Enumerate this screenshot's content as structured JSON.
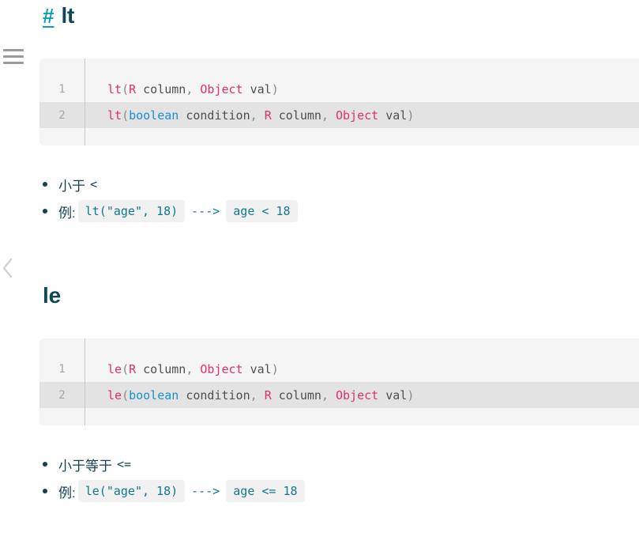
{
  "rail": {
    "menu_icon": "hamburger-menu-icon",
    "collapse_icon": "chevron-left-icon"
  },
  "sections": [
    {
      "id": "lt",
      "anchor": "#",
      "title": "lt",
      "code": {
        "lines": [
          {
            "number": "1",
            "tokens": [
              {
                "t": "lt",
                "c": "fn"
              },
              {
                "t": "(",
                "c": "punc"
              },
              {
                "t": "R",
                "c": "type"
              },
              {
                "t": " column",
                "c": "plain"
              },
              {
                "t": ",",
                "c": "punc"
              },
              {
                "t": " ",
                "c": "plain"
              },
              {
                "t": "Object",
                "c": "type"
              },
              {
                "t": " val",
                "c": "plain"
              },
              {
                "t": ")",
                "c": "punc"
              }
            ]
          },
          {
            "number": "2",
            "highlighted": true,
            "tokens": [
              {
                "t": "lt",
                "c": "fn"
              },
              {
                "t": "(",
                "c": "punc"
              },
              {
                "t": "boolean",
                "c": "kw"
              },
              {
                "t": " condition",
                "c": "plain"
              },
              {
                "t": ",",
                "c": "punc"
              },
              {
                "t": " ",
                "c": "plain"
              },
              {
                "t": "R",
                "c": "type"
              },
              {
                "t": " column",
                "c": "plain"
              },
              {
                "t": ",",
                "c": "punc"
              },
              {
                "t": " ",
                "c": "plain"
              },
              {
                "t": "Object",
                "c": "type"
              },
              {
                "t": " val",
                "c": "plain"
              },
              {
                "t": ")",
                "c": "punc"
              }
            ]
          }
        ]
      },
      "bullets": [
        {
          "label": "小于",
          "operator": "<",
          "parts": []
        },
        {
          "label": "例:",
          "operator": "",
          "parts": [
            {
              "kind": "code",
              "text": "lt(\"age\", 18)"
            },
            {
              "kind": "arrow",
              "text": "--->"
            },
            {
              "kind": "code",
              "text": "age < 18"
            }
          ]
        }
      ]
    },
    {
      "id": "le",
      "anchor": "",
      "title": "le",
      "code": {
        "lines": [
          {
            "number": "1",
            "tokens": [
              {
                "t": "le",
                "c": "fn"
              },
              {
                "t": "(",
                "c": "punc"
              },
              {
                "t": "R",
                "c": "type"
              },
              {
                "t": " column",
                "c": "plain"
              },
              {
                "t": ",",
                "c": "punc"
              },
              {
                "t": " ",
                "c": "plain"
              },
              {
                "t": "Object",
                "c": "type"
              },
              {
                "t": " val",
                "c": "plain"
              },
              {
                "t": ")",
                "c": "punc"
              }
            ]
          },
          {
            "number": "2",
            "highlighted": true,
            "tokens": [
              {
                "t": "le",
                "c": "fn"
              },
              {
                "t": "(",
                "c": "punc"
              },
              {
                "t": "boolean",
                "c": "kw"
              },
              {
                "t": " condition",
                "c": "plain"
              },
              {
                "t": ",",
                "c": "punc"
              },
              {
                "t": " ",
                "c": "plain"
              },
              {
                "t": "R",
                "c": "type"
              },
              {
                "t": " column",
                "c": "plain"
              },
              {
                "t": ",",
                "c": "punc"
              },
              {
                "t": " ",
                "c": "plain"
              },
              {
                "t": "Object",
                "c": "type"
              },
              {
                "t": " val",
                "c": "plain"
              },
              {
                "t": ")",
                "c": "punc"
              }
            ]
          }
        ]
      },
      "bullets": [
        {
          "label": "小于等于",
          "operator": "<=",
          "parts": []
        },
        {
          "label": "例:",
          "operator": "",
          "parts": [
            {
              "kind": "code",
              "text": "le(\"age\", 18)"
            },
            {
              "kind": "arrow",
              "text": "--->"
            },
            {
              "kind": "code",
              "text": "age <= 18"
            }
          ]
        }
      ]
    }
  ],
  "colors": {
    "heading": "#0c4a56",
    "anchor": "#0a9bbd",
    "code_bg": "#f5f5f5",
    "code_row_alt": "#e3e3e3",
    "token_type": "#e0306b",
    "token_keyword": "#1a8fd1",
    "inline_code": "#12788f"
  },
  "layout": {
    "section_tops": [
      4,
      358
    ],
    "codeblock_tops": [
      74,
      428
    ],
    "bullets_tops": [
      216,
      570
    ]
  }
}
